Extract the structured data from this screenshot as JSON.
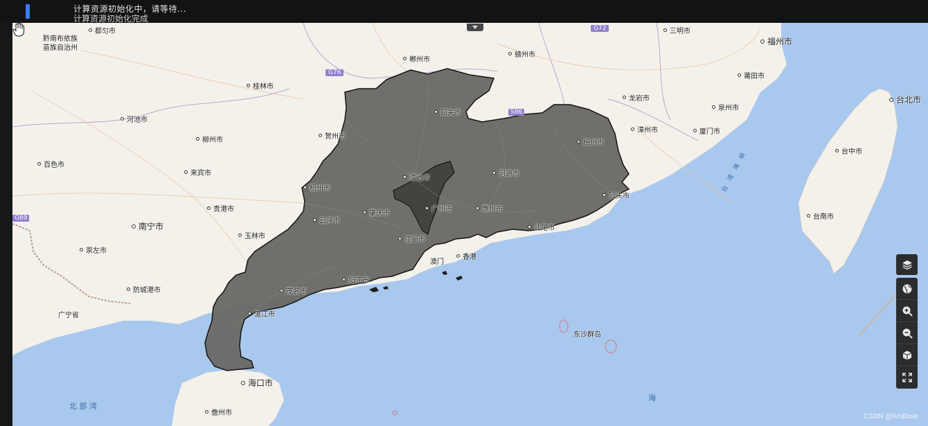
{
  "status": {
    "message": "计算资源初始化中，请等待...",
    "message_secondary": "计算资源初始化完成"
  },
  "map": {
    "highlight_region": "广东省",
    "cities": [
      {
        "name": "都匀市",
        "dot": true
      },
      {
        "name": "黔南布依族",
        "dot": false
      },
      {
        "name": "苗族自治州",
        "dot": false
      },
      {
        "name": "桂林市",
        "dot": true
      },
      {
        "name": "河池市",
        "dot": true
      },
      {
        "name": "柳州市",
        "dot": true
      },
      {
        "name": "百色市",
        "dot": true
      },
      {
        "name": "来宾市",
        "dot": true
      },
      {
        "name": "贵港市",
        "dot": true
      },
      {
        "name": "南宁市",
        "dot": true,
        "major": true
      },
      {
        "name": "玉林市",
        "dot": true
      },
      {
        "name": "崇左市",
        "dot": true
      },
      {
        "name": "防城港市",
        "dot": true
      },
      {
        "name": "广宁省",
        "dot": false
      },
      {
        "name": "郴州市",
        "dot": true
      },
      {
        "name": "赣州市",
        "dot": true
      },
      {
        "name": "三明市",
        "dot": true
      },
      {
        "name": "福州市",
        "dot": true,
        "major": true
      },
      {
        "name": "莆田市",
        "dot": true
      },
      {
        "name": "台北市",
        "dot": true,
        "major": true
      },
      {
        "name": "龙岩市",
        "dot": true
      },
      {
        "name": "泉州市",
        "dot": true
      },
      {
        "name": "漳州市",
        "dot": true
      },
      {
        "name": "厦门市",
        "dot": true
      },
      {
        "name": "台中市",
        "dot": true
      },
      {
        "name": "台南市",
        "dot": true
      },
      {
        "name": "韶关市",
        "dot": true
      },
      {
        "name": "贺州市",
        "dot": true
      },
      {
        "name": "梅州市",
        "dot": true
      },
      {
        "name": "河源市",
        "dot": true
      },
      {
        "name": "清远市",
        "dot": true
      },
      {
        "name": "梧州市",
        "dot": true
      },
      {
        "name": "肇庆市",
        "dot": true
      },
      {
        "name": "广州市",
        "dot": true
      },
      {
        "name": "惠州市",
        "dot": true
      },
      {
        "name": "汕头市",
        "dot": true
      },
      {
        "name": "云浮市",
        "dot": true
      },
      {
        "name": "汕尾市",
        "dot": true
      },
      {
        "name": "江门市",
        "dot": true
      },
      {
        "name": "澳门",
        "dot": false
      },
      {
        "name": "香港",
        "dot": true
      },
      {
        "name": "茂名市",
        "dot": true
      },
      {
        "name": "阳江市",
        "dot": true
      },
      {
        "name": "湛江市",
        "dot": true
      },
      {
        "name": "海口市",
        "dot": true,
        "major": true
      },
      {
        "name": "儋州市",
        "dot": true
      },
      {
        "name": "东沙群岛",
        "dot": false
      }
    ],
    "water_labels": [
      "北 部 湾",
      "海",
      "台 湾 海 峡"
    ],
    "road_shields": [
      "G72",
      "G76",
      "G69",
      "S86"
    ]
  },
  "controls": {
    "layers": "layers-icon",
    "globe": "globe-icon",
    "zoom_in": "zoom-in-icon",
    "zoom_out": "zoom-out-icon",
    "view_3d": "cube-icon",
    "fullscreen": "fullscreen-icon"
  },
  "attribution": "CSDN @KmBase",
  "colors": {
    "sea": "#a9c8ee",
    "land": "#f4f1ea",
    "highlight_fill": "#6b6a66",
    "guangzhou_fill": "#4b4a47",
    "border": "#1a1a1a"
  }
}
